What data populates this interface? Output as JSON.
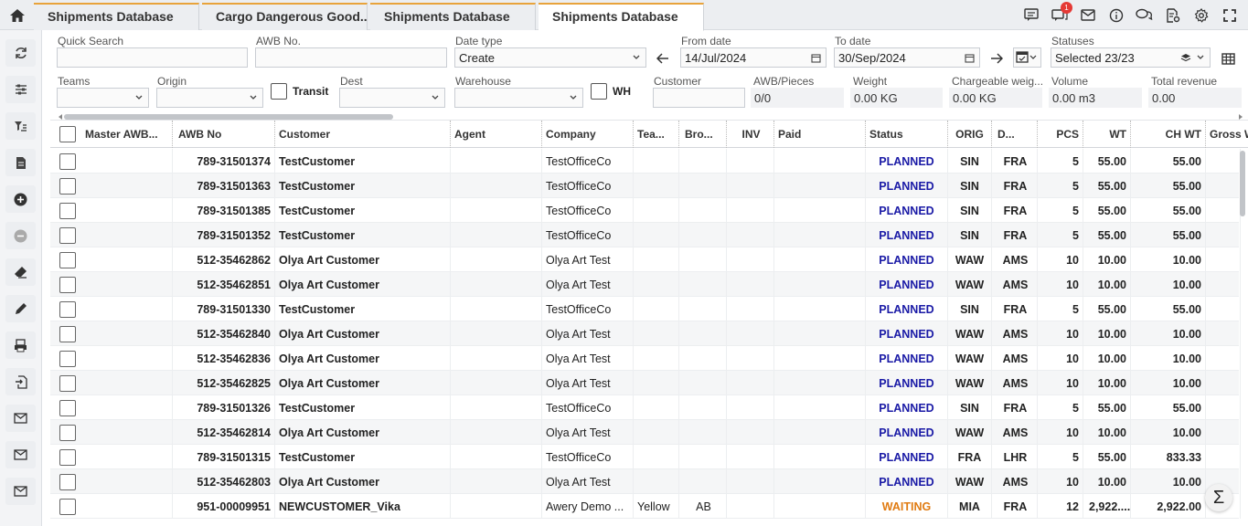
{
  "tabs": [
    {
      "label": "Shipments Database"
    },
    {
      "label": "Cargo Dangerous Good..."
    },
    {
      "label": "Shipments Database"
    },
    {
      "label": "Shipments Database"
    }
  ],
  "header_icons": [
    "message-icon",
    "chat-icon",
    "mail-icon",
    "info-icon",
    "conversation-icon",
    "document-settings-icon",
    "gear-icon",
    "fullscreen-icon"
  ],
  "notification_count": "1",
  "sidebar_icons": [
    "refresh-icon",
    "sliders-icon",
    "filter-list-icon",
    "document-icon",
    "plus-circle-icon",
    "minus-circle-icon",
    "eraser-icon",
    "pen-icon",
    "print-icon",
    "import-icon",
    "mail-icon",
    "mail-icon",
    "mail-icon"
  ],
  "filters": {
    "quick_search": {
      "label": "Quick Search",
      "value": ""
    },
    "awb_no": {
      "label": "AWB No.",
      "value": ""
    },
    "date_type": {
      "label": "Date type",
      "value": "Create"
    },
    "from_date": {
      "label": "From date",
      "value": "14/Jul/2024"
    },
    "to_date": {
      "label": "To date",
      "value": "30/Sep/2024"
    },
    "statuses": {
      "label": "Statuses",
      "value": "Selected 23/23"
    },
    "teams": {
      "label": "Teams",
      "value": ""
    },
    "origin": {
      "label": "Origin",
      "value": ""
    },
    "transit": {
      "label": "Transit"
    },
    "dest": {
      "label": "Dest",
      "value": ""
    },
    "warehouse": {
      "label": "Warehouse",
      "value": ""
    },
    "wh": {
      "label": "WH"
    },
    "customer": {
      "label": "Customer",
      "value": ""
    },
    "awb_pieces": {
      "label": "AWB/Pieces",
      "value": "0/0"
    },
    "weight": {
      "label": "Weight",
      "value": "0.00 KG"
    },
    "chargeable_weight": {
      "label": "Chargeable weig...",
      "value": "0.00 KG"
    },
    "volume": {
      "label": "Volume",
      "value": "0.00 m3"
    },
    "total_revenue": {
      "label": "Total revenue",
      "value": "0.00"
    }
  },
  "columns": [
    "Master AWB...",
    "AWB No",
    "Customer",
    "Agent",
    "Company",
    "Tea...",
    "Bro...",
    "INV",
    "Paid",
    "Status",
    "ORIG",
    "D...",
    "PCS",
    "WT",
    "CH WT",
    "Gross W"
  ],
  "rows": [
    {
      "awb": "789-31501374",
      "customer": "TestCustomer",
      "company": "TestOfficeCo",
      "team": "",
      "broker": "",
      "status": "PLANNED",
      "orig": "SIN",
      "dest": "FRA",
      "pcs": "5",
      "wt": "55.00",
      "chwt": "55.00"
    },
    {
      "awb": "789-31501363",
      "customer": "TestCustomer",
      "company": "TestOfficeCo",
      "team": "",
      "broker": "",
      "status": "PLANNED",
      "orig": "SIN",
      "dest": "FRA",
      "pcs": "5",
      "wt": "55.00",
      "chwt": "55.00"
    },
    {
      "awb": "789-31501385",
      "customer": "TestCustomer",
      "company": "TestOfficeCo",
      "team": "",
      "broker": "",
      "status": "PLANNED",
      "orig": "SIN",
      "dest": "FRA",
      "pcs": "5",
      "wt": "55.00",
      "chwt": "55.00"
    },
    {
      "awb": "789-31501352",
      "customer": "TestCustomer",
      "company": "TestOfficeCo",
      "team": "",
      "broker": "",
      "status": "PLANNED",
      "orig": "SIN",
      "dest": "FRA",
      "pcs": "5",
      "wt": "55.00",
      "chwt": "55.00"
    },
    {
      "awb": "512-35462862",
      "customer": "Olya Art Customer",
      "company": "Olya Art Test",
      "team": "",
      "broker": "",
      "status": "PLANNED",
      "orig": "WAW",
      "dest": "AMS",
      "pcs": "10",
      "wt": "10.00",
      "chwt": "10.00"
    },
    {
      "awb": "512-35462851",
      "customer": "Olya Art Customer",
      "company": "Olya Art Test",
      "team": "",
      "broker": "",
      "status": "PLANNED",
      "orig": "WAW",
      "dest": "AMS",
      "pcs": "10",
      "wt": "10.00",
      "chwt": "10.00"
    },
    {
      "awb": "789-31501330",
      "customer": "TestCustomer",
      "company": "TestOfficeCo",
      "team": "",
      "broker": "",
      "status": "PLANNED",
      "orig": "SIN",
      "dest": "FRA",
      "pcs": "5",
      "wt": "55.00",
      "chwt": "55.00"
    },
    {
      "awb": "512-35462840",
      "customer": "Olya Art Customer",
      "company": "Olya Art Test",
      "team": "",
      "broker": "",
      "status": "PLANNED",
      "orig": "WAW",
      "dest": "AMS",
      "pcs": "10",
      "wt": "10.00",
      "chwt": "10.00"
    },
    {
      "awb": "512-35462836",
      "customer": "Olya Art Customer",
      "company": "Olya Art Test",
      "team": "",
      "broker": "",
      "status": "PLANNED",
      "orig": "WAW",
      "dest": "AMS",
      "pcs": "10",
      "wt": "10.00",
      "chwt": "10.00"
    },
    {
      "awb": "512-35462825",
      "customer": "Olya Art Customer",
      "company": "Olya Art Test",
      "team": "",
      "broker": "",
      "status": "PLANNED",
      "orig": "WAW",
      "dest": "AMS",
      "pcs": "10",
      "wt": "10.00",
      "chwt": "10.00"
    },
    {
      "awb": "789-31501326",
      "customer": "TestCustomer",
      "company": "TestOfficeCo",
      "team": "",
      "broker": "",
      "status": "PLANNED",
      "orig": "SIN",
      "dest": "FRA",
      "pcs": "5",
      "wt": "55.00",
      "chwt": "55.00"
    },
    {
      "awb": "512-35462814",
      "customer": "Olya Art Customer",
      "company": "Olya Art Test",
      "team": "",
      "broker": "",
      "status": "PLANNED",
      "orig": "WAW",
      "dest": "AMS",
      "pcs": "10",
      "wt": "10.00",
      "chwt": "10.00"
    },
    {
      "awb": "789-31501315",
      "customer": "TestCustomer",
      "company": "TestOfficeCo",
      "team": "",
      "broker": "",
      "status": "PLANNED",
      "orig": "FRA",
      "dest": "LHR",
      "pcs": "5",
      "wt": "55.00",
      "chwt": "833.33"
    },
    {
      "awb": "512-35462803",
      "customer": "Olya Art Customer",
      "company": "Olya Art Test",
      "team": "",
      "broker": "",
      "status": "PLANNED",
      "orig": "WAW",
      "dest": "AMS",
      "pcs": "10",
      "wt": "10.00",
      "chwt": "10.00"
    },
    {
      "awb": "951-00009951",
      "customer": "NEWCUSTOMER_Vika",
      "company": "Awery Demo ...",
      "team": "Yellow",
      "broker": "AB",
      "status": "WAITING",
      "orig": "MIA",
      "dest": "FRA",
      "pcs": "12",
      "wt": "2,922....",
      "chwt": "2,922.00"
    }
  ],
  "colors": {
    "planned": "#1a1aa6",
    "waiting": "#e07b12",
    "tab_accent": "#e8a33b"
  },
  "sum_button": "Σ"
}
